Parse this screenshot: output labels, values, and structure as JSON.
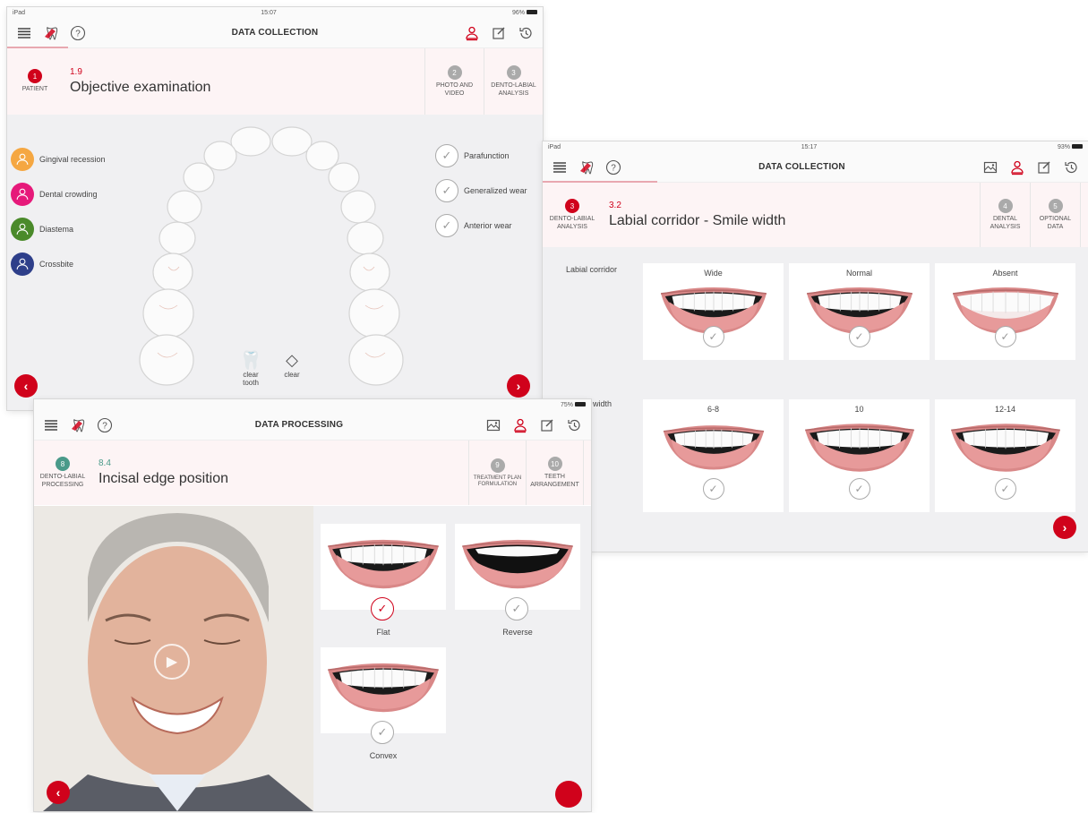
{
  "screen1": {
    "status": {
      "left": "iPad",
      "time": "15:07",
      "battery": "96%"
    },
    "toolbar": {
      "title": "DATA COLLECTION"
    },
    "header": {
      "current_step": {
        "num": "1",
        "label": "PATIENT"
      },
      "sub": "1.9",
      "title": "Objective examination",
      "next_steps": [
        {
          "num": "2",
          "label": "PHOTO AND VIDEO"
        },
        {
          "num": "3",
          "label": "DENTO-LABIAL ANALYSIS"
        }
      ]
    },
    "conditions": [
      {
        "label": "Gingival recession",
        "color": "#f5a742"
      },
      {
        "label": "Dental crowding",
        "color": "#e6197a"
      },
      {
        "label": "Diastema",
        "color": "#4a8a2a"
      },
      {
        "label": "Crossbite",
        "color": "#2e3f8a"
      }
    ],
    "habits": [
      {
        "label": "Parafunction"
      },
      {
        "label": "Generalized wear"
      },
      {
        "label": "Anterior wear"
      }
    ],
    "tools": [
      {
        "label": "clear tooth"
      },
      {
        "label": "clear"
      }
    ]
  },
  "screen2": {
    "status": {
      "left": "iPad",
      "time": "15:17",
      "battery": "93%"
    },
    "toolbar": {
      "title": "DATA COLLECTION"
    },
    "header": {
      "current_step": {
        "num": "3",
        "label": "DENTO-LABIAL ANALYSIS"
      },
      "sub": "3.2",
      "title": "Labial corridor - Smile width",
      "next_steps": [
        {
          "num": "4",
          "label": "DENTAL ANALYSIS"
        },
        {
          "num": "5",
          "label": "OPTIONAL DATA"
        }
      ]
    },
    "row1": {
      "label": "Labial corridor",
      "options": [
        {
          "label": "Wide",
          "corridor": "wide"
        },
        {
          "label": "Normal",
          "corridor": "normal"
        },
        {
          "label": "Absent",
          "corridor": "absent"
        }
      ]
    },
    "row2": {
      "label": "width",
      "options": [
        {
          "label": "6-8",
          "corridor": "normal"
        },
        {
          "label": "10",
          "corridor": "normal"
        },
        {
          "label": "12-14",
          "corridor": "normal"
        }
      ]
    }
  },
  "screen3": {
    "status": {
      "battery": "75%"
    },
    "toolbar": {
      "title": "DATA PROCESSING"
    },
    "header": {
      "current_step": {
        "num": "8",
        "label": "DENTO-LABIAL PROCESSING"
      },
      "sub": "8.4",
      "title": "Incisal edge position",
      "next_steps": [
        {
          "num": "9",
          "label": "TREATMENT PLAN FORMULATION"
        },
        {
          "num": "10",
          "label": "TEETH ARRANGEMENT"
        }
      ]
    },
    "options": [
      {
        "label": "Flat",
        "selected": true,
        "shape": "flat"
      },
      {
        "label": "Reverse",
        "selected": false,
        "shape": "reverse"
      },
      {
        "label": "Convex",
        "selected": false,
        "shape": "convex"
      }
    ]
  }
}
